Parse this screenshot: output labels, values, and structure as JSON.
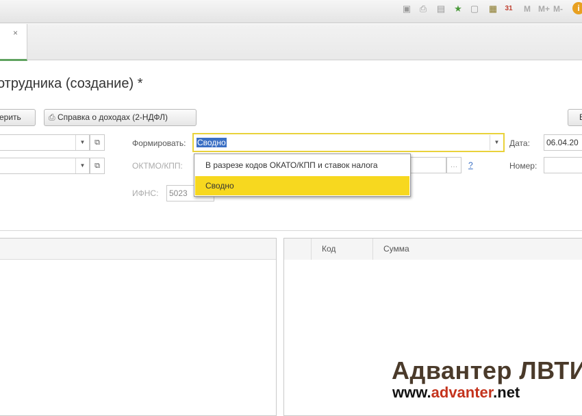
{
  "toolbar": {
    "m_label": "M",
    "m_plus_label": "M+",
    "m_minus_label": "M-",
    "calendar_day": "31"
  },
  "tab": {
    "close_glyph": "×"
  },
  "form": {
    "title": "отрудника (создание) *",
    "check_button": "ерить",
    "income_report_button": "Справка о доходах (2-НДФЛ)",
    "right_button": "В",
    "generate_label": "Формировать:",
    "generate_value": "Сводно",
    "date_label": "Дата:",
    "date_value": "06.04.20",
    "oktmo_label": "ОКТМО/КПП:",
    "oktmo_help": "?",
    "number_label": "Номер:",
    "ifns_label": "ИФНС:",
    "ifns_value": "5023"
  },
  "dropdown": {
    "options": [
      {
        "label": "В разрезе кодов ОКАТО/КПП и ставок налога",
        "selected": false
      },
      {
        "label": "Сводно",
        "selected": true
      }
    ]
  },
  "table": {
    "columns": [
      "Код",
      "Сумма"
    ]
  },
  "watermark": {
    "brand": "Адвантер ЛВТИ",
    "url_prefix": "www.",
    "url_highlight": "advanter",
    "url_suffix": ".net"
  }
}
